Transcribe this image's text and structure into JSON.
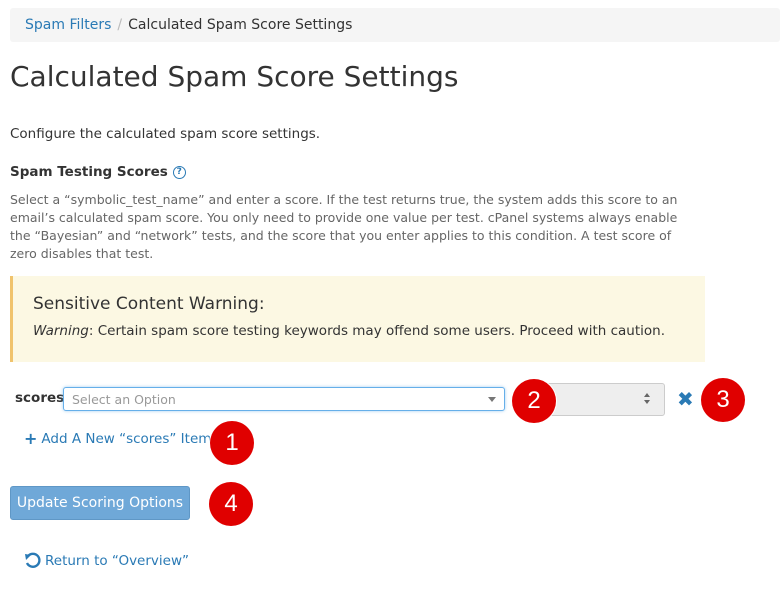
{
  "breadcrumb": {
    "parent": "Spam Filters",
    "separator": "/",
    "current": "Calculated Spam Score Settings"
  },
  "page_title": "Calculated Spam Score Settings",
  "intro": "Configure the calculated spam score settings.",
  "section": {
    "title": "Spam Testing Scores",
    "help_icon": "question-circle-icon",
    "description": "Select a “symbolic_test_name” and enter a score. If the test returns true, the system adds this score to an email’s calculated spam score. You only need to provide one value per test. cPanel systems always enable the “Bayesian” and “network” tests, and the score that you enter applies to this condition. A test score of zero disables that test."
  },
  "warning": {
    "title": "Sensitive Content Warning:",
    "label": "Warning",
    "text": ": Certain spam score testing keywords may offend some users. Proceed with caution."
  },
  "scores": {
    "label": "scores",
    "select_placeholder": "Select an Option",
    "score_value": "",
    "add_label": "Add A New “scores” Item"
  },
  "update_button": "Update Scoring Options",
  "return_link": "Return to “Overview”",
  "annotations": [
    "1",
    "2",
    "3",
    "4"
  ],
  "colors": {
    "link": "#2a7ab5",
    "warning_bg": "#fcf8e3",
    "badge": "#e00000",
    "button": "#6fa8d8"
  }
}
